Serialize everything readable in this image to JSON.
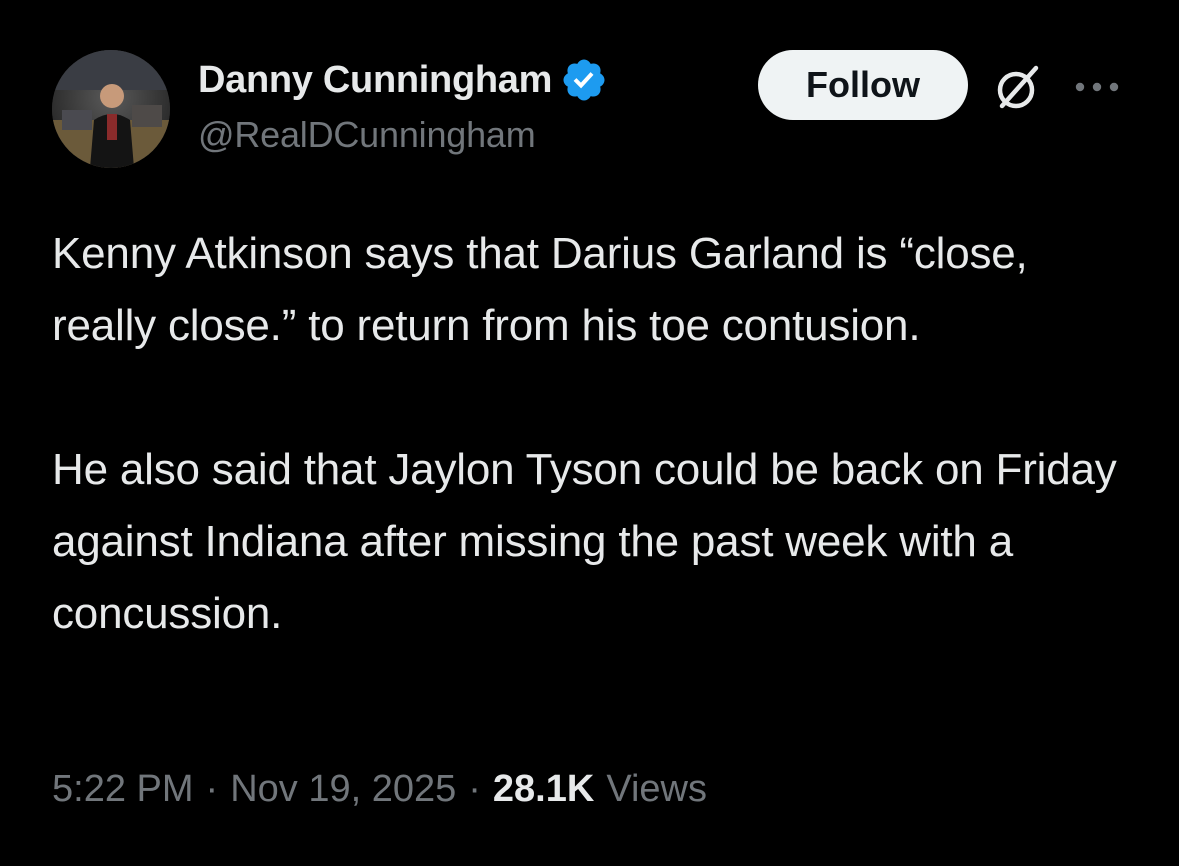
{
  "author": {
    "display_name": "Danny Cunningham",
    "handle": "@RealDCunningham",
    "verified": true,
    "verified_color": "#1d9bf0"
  },
  "actions": {
    "follow_label": "Follow",
    "grok_icon": "grok-icon",
    "more_icon": "more-icon"
  },
  "tweet": {
    "paragraphs": [
      "Kenny Atkinson says that Darius Garland is “close, really close.” to return from his toe contusion.",
      "He also said that Jaylon Tyson could be back on Friday against Indiana after missing the past week with a concussion."
    ]
  },
  "meta": {
    "time": "5:22 PM",
    "separator": "·",
    "date": "Nov 19, 2025",
    "views_count": "28.1K",
    "views_label": "Views"
  },
  "colors": {
    "background": "#000000",
    "text_primary": "#e7e9ea",
    "text_secondary": "#71767b",
    "button_bg": "#eff3f4"
  }
}
